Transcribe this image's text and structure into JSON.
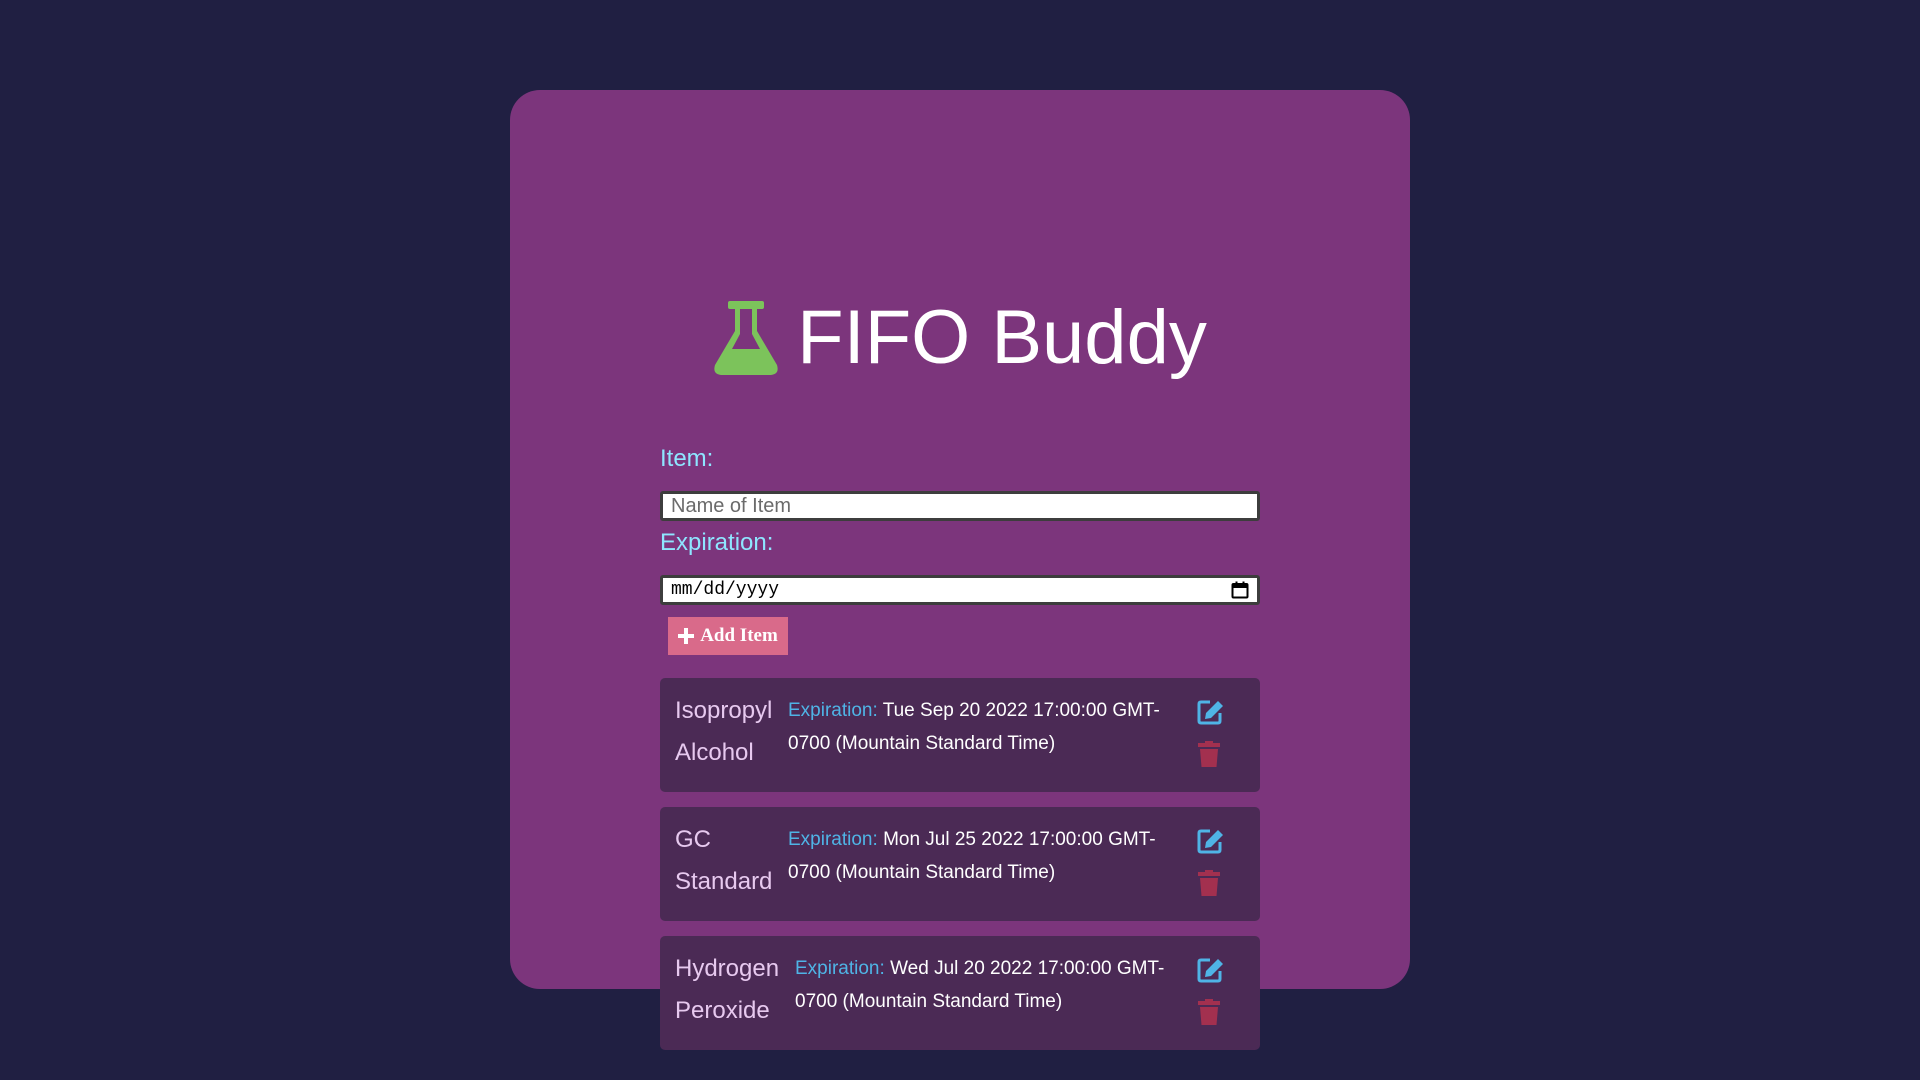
{
  "app": {
    "title": "FIFO Buddy",
    "icon": "flask-icon"
  },
  "colors": {
    "background": "#201f42",
    "card": "#7c357c",
    "item_card": "#4b2a55",
    "label": "#8ee6ff",
    "accent_button": "#d96a8a",
    "edit_icon": "#4fb4e6",
    "trash_icon": "#a3304f",
    "flask_icon": "#7cc35b"
  },
  "form": {
    "item_label": "Item:",
    "item_placeholder": "Name of Item",
    "item_value": "",
    "expiration_label": "Expiration:",
    "expiration_placeholder": "mm/dd/yyyy",
    "add_button_label": "Add Item"
  },
  "items": [
    {
      "name": "Isopropyl Alcohol",
      "expiration_label": "Expiration:",
      "expiration": "Tue Sep 20 2022 17:00:00 GMT-0700 (Mountain Standard Time)"
    },
    {
      "name": "GC Standard",
      "expiration_label": "Expiration:",
      "expiration": "Mon Jul 25 2022 17:00:00 GMT-0700 (Mountain Standard Time)"
    },
    {
      "name": "Hydrogen Peroxide",
      "expiration_label": "Expiration:",
      "expiration": "Wed Jul 20 2022 17:00:00 GMT-0700 (Mountain Standard Time)"
    }
  ]
}
